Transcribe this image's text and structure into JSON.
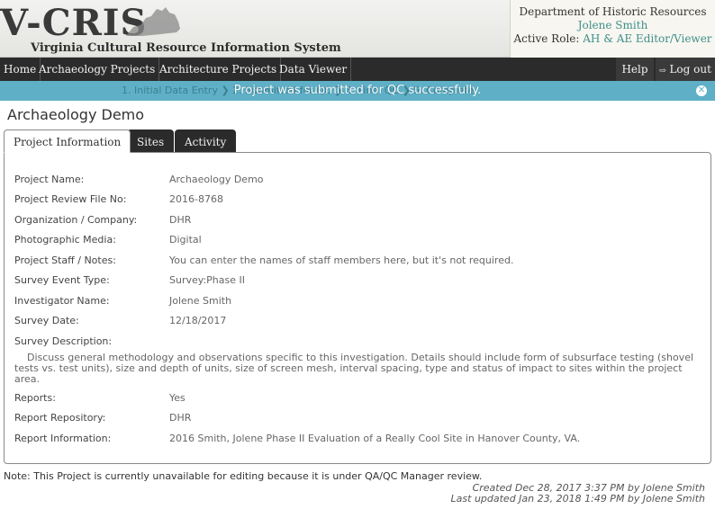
{
  "header": {
    "logo_main": "V-CRIS",
    "logo_sub": "Virginia Cultural Resource Information System",
    "department": "Department of Historic Resources",
    "user_name": "Jolene Smith",
    "role_label": "Active Role:",
    "role_value": "AH & AE Editor/Viewer"
  },
  "nav": {
    "items": [
      "Home",
      "Archaeology Projects",
      "Architecture Projects",
      "Data Viewer"
    ],
    "help": "Help",
    "logout": "Log out"
  },
  "alert": {
    "steps": "1. Initial Data Entry  ❯  2. Submitted for QC  ❯  3. Final QC  ❯  5. Complete",
    "message": "Project was submitted for QC successfully.",
    "close_icon": "close-circle-icon"
  },
  "page": {
    "title": "Archaeology Demo"
  },
  "tabs": [
    "Project Information",
    "Sites",
    "Activity"
  ],
  "fields": [
    {
      "label": "Project Name:",
      "value": "Archaeology Demo"
    },
    {
      "label": "Project Review File No:",
      "value": "2016-8768"
    },
    {
      "label": "Organization / Company:",
      "value": "DHR"
    },
    {
      "label": "Photographic Media:",
      "value": "Digital"
    },
    {
      "label": "Project Staff / Notes:",
      "value": "You can enter the names of staff members here, but it's not required."
    },
    {
      "label": "Survey Event Type:",
      "value": "Survey:Phase II"
    },
    {
      "label": "Investigator Name:",
      "value": "Jolene Smith"
    },
    {
      "label": "Survey Date:",
      "value": "12/18/2017"
    },
    {
      "label": "Survey Description:",
      "value": ""
    }
  ],
  "survey_description": "Discuss general methodology and observations specific to this investigation. Details should include form of subsurface testing (shovel tests vs. test units), size and depth of units, size of screen mesh, interval spacing, type and status of impact to sites within the project area.",
  "fields_after": [
    {
      "label": "Reports:",
      "value": "Yes"
    },
    {
      "label": "Report Repository:",
      "value": "DHR"
    },
    {
      "label": "Report Information:",
      "value": "2016 Smith, Jolene Phase II Evaluation of a Really Cool Site in Hanover County, VA."
    }
  ],
  "footer": {
    "note": "Note: This Project is currently unavailable for editing because it is under QA/QC Manager review.",
    "created": "Created Dec 28, 2017 3:37 PM by Jolene Smith",
    "updated": "Last updated Jan 23, 2018 1:49 PM by Jolene Smith"
  },
  "colors": {
    "accent_teal": "#3f8f8a",
    "alert_bg": "#5fb0c6",
    "nav_bg": "#2b2b2b"
  }
}
